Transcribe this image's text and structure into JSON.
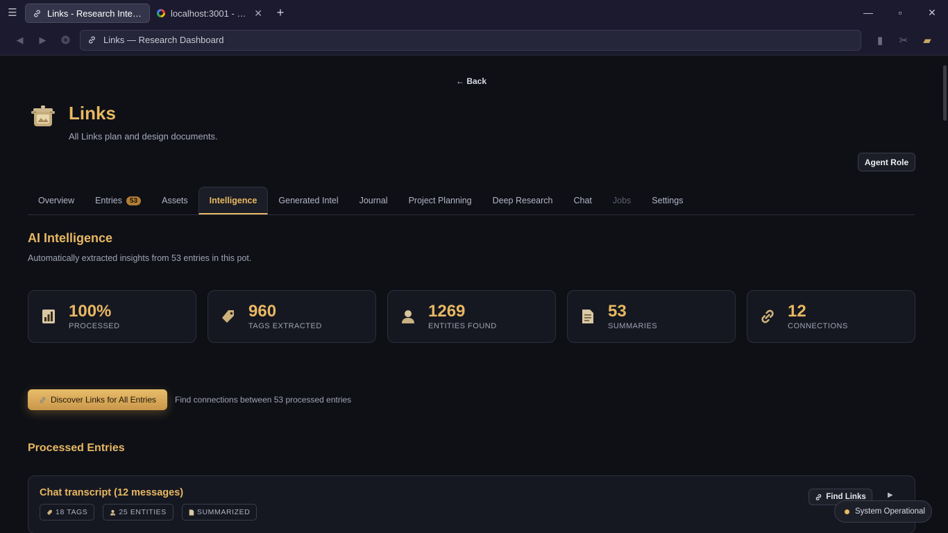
{
  "browser": {
    "tabs": [
      {
        "title": "Links - Research Intellige...",
        "active": true
      },
      {
        "title": "localhost:3001 - Goo...",
        "active": false
      }
    ],
    "address": "Links — Research Dashboard"
  },
  "page": {
    "back": "← Back",
    "title": "Links",
    "subtitle": "All Links plan and design documents.",
    "agent_role": "Agent Role",
    "tabs": [
      {
        "label": "Overview"
      },
      {
        "label": "Entries",
        "badge": "53"
      },
      {
        "label": "Assets"
      },
      {
        "label": "Intelligence",
        "active": true
      },
      {
        "label": "Generated Intel"
      },
      {
        "label": "Journal"
      },
      {
        "label": "Project Planning"
      },
      {
        "label": "Deep Research"
      },
      {
        "label": "Chat"
      },
      {
        "label": "Jobs",
        "disabled": true
      },
      {
        "label": "Settings"
      }
    ]
  },
  "intelligence": {
    "title": "AI Intelligence",
    "subtitle": "Automatically extracted insights from 53 entries in this pot.",
    "stats": [
      {
        "value": "100%",
        "label": "PROCESSED",
        "icon": "bar-chart-icon"
      },
      {
        "value": "960",
        "label": "TAGS EXTRACTED",
        "icon": "tag-icon"
      },
      {
        "value": "1269",
        "label": "ENTITIES FOUND",
        "icon": "person-icon"
      },
      {
        "value": "53",
        "label": "SUMMARIES",
        "icon": "document-icon"
      },
      {
        "value": "12",
        "label": "CONNECTIONS",
        "icon": "link-icon"
      }
    ],
    "discover_button": "Discover Links for All Entries",
    "discover_hint": "Find connections between 53 processed entries"
  },
  "processed": {
    "title": "Processed Entries",
    "entries": [
      {
        "title": "Chat transcript (12 messages)",
        "chips": [
          "18 TAGS",
          "25 ENTITIES",
          "SUMMARIZED"
        ],
        "find_links": "Find Links"
      }
    ]
  },
  "status": {
    "text": "System Operational"
  },
  "colors": {
    "accent": "#e8b862",
    "background": "#0e1016",
    "card": "#161821"
  }
}
